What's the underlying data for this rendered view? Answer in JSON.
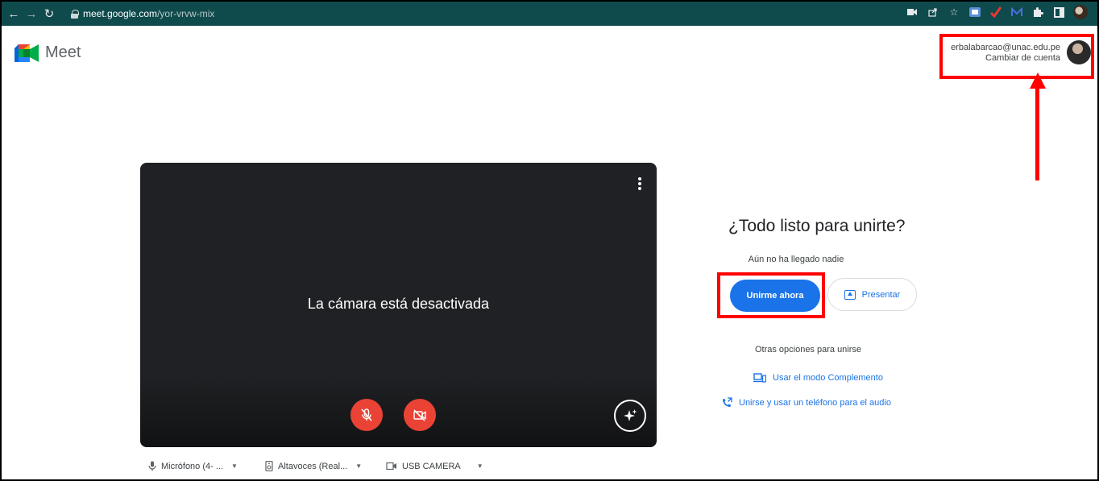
{
  "browser": {
    "url_host": "meet.google.com",
    "url_path": "/yor-vrvw-mix"
  },
  "app": {
    "title": "Meet"
  },
  "account": {
    "email": "erbalabarcao@unac.edu.pe",
    "switch_label": "Cambiar de cuenta"
  },
  "preview": {
    "camera_off_text": "La cámara está desactivada"
  },
  "devices": {
    "microphone": "Micrófono (4- ...",
    "speakers": "Altavoces (Real...",
    "camera": "USB CAMERA"
  },
  "join": {
    "heading": "¿Todo listo para unirte?",
    "status": "Aún no ha llegado nadie",
    "join_label": "Unirme ahora",
    "present_label": "Presentar",
    "other_options": "Otras opciones para unirse",
    "companion_mode": "Usar el modo Complemento",
    "phone_audio": "Unirse y usar un teléfono para el audio"
  },
  "colors": {
    "chrome_bg": "#0f4a4c",
    "primary": "#1a73e8",
    "danger": "#ea4335",
    "highlight": "#ff0000"
  }
}
